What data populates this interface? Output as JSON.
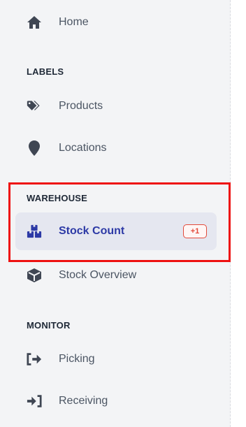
{
  "nav": {
    "home": {
      "label": "Home",
      "icon": "home-icon"
    },
    "labels_section": "LABELS",
    "products": {
      "label": "Products",
      "icon": "tags-icon"
    },
    "locations": {
      "label": "Locations",
      "icon": "map-pin-icon"
    },
    "warehouse_section": "WAREHOUSE",
    "stock_count": {
      "label": "Stock Count",
      "icon": "boxes-icon",
      "badge": "+1",
      "active": true
    },
    "stock_overview": {
      "label": "Stock Overview",
      "icon": "box-icon"
    },
    "monitor_section": "MONITOR",
    "picking": {
      "label": "Picking",
      "icon": "exit-arrow-icon"
    },
    "receiving": {
      "label": "Receiving",
      "icon": "enter-arrow-icon"
    }
  },
  "colors": {
    "sidebar_bg": "#f3f4f6",
    "active_bg": "#e5e7f0",
    "active_text": "#2d3aa6",
    "icon": "#3f4653",
    "badge": "#e24a3b",
    "highlight": "#ee1111"
  }
}
